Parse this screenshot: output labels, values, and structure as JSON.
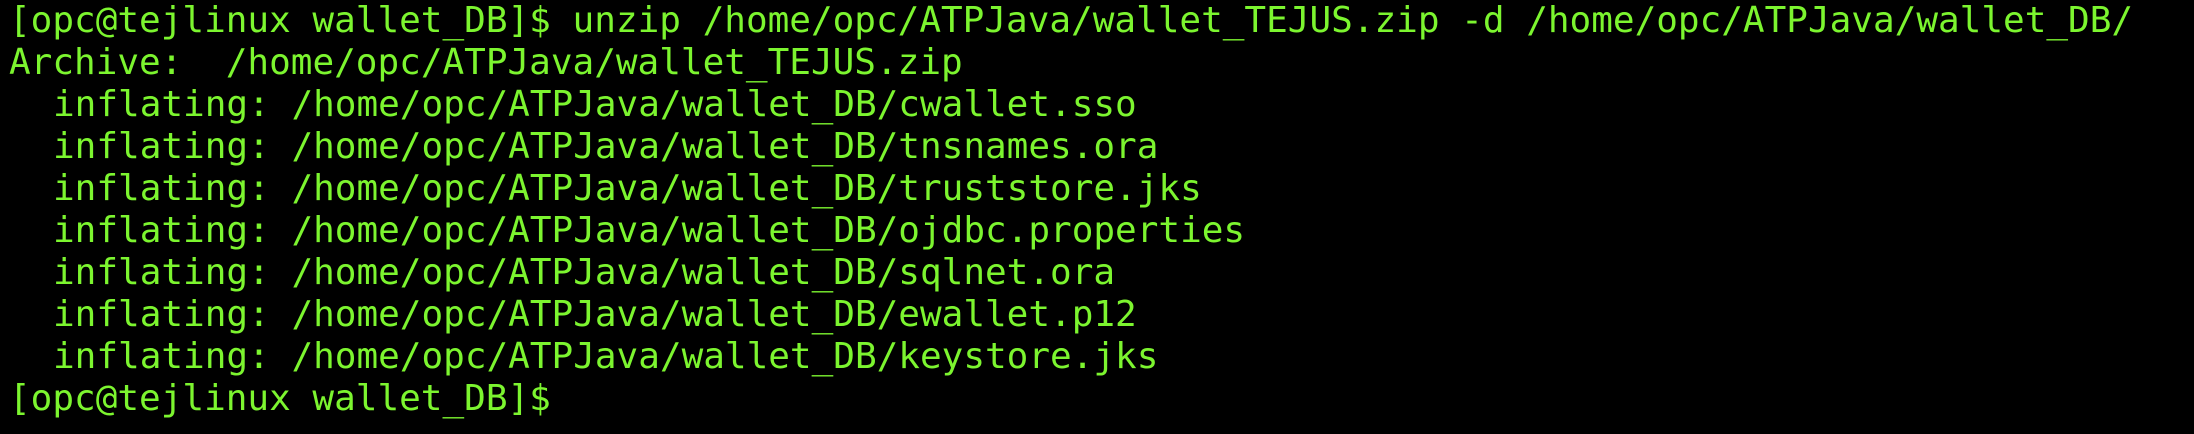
{
  "terminal": {
    "text_color": "#7cf52f",
    "background_color": "#000000",
    "command_line": {
      "prompt": "[opc@tejlinux wallet_DB]$",
      "command": "unzip /home/opc/ATPJava/wallet_TEJUS.zip -d /home/opc/ATPJava/wallet_DB/"
    },
    "archive_line": {
      "label": "Archive:",
      "path": "/home/opc/ATPJava/wallet_TEJUS.zip"
    },
    "inflating_lines": [
      {
        "label": "inflating:",
        "path": "/home/opc/ATPJava/wallet_DB/cwallet.sso"
      },
      {
        "label": "inflating:",
        "path": "/home/opc/ATPJava/wallet_DB/tnsnames.ora"
      },
      {
        "label": "inflating:",
        "path": "/home/opc/ATPJava/wallet_DB/truststore.jks"
      },
      {
        "label": "inflating:",
        "path": "/home/opc/ATPJava/wallet_DB/ojdbc.properties"
      },
      {
        "label": "inflating:",
        "path": "/home/opc/ATPJava/wallet_DB/sqlnet.ora"
      },
      {
        "label": "inflating:",
        "path": "/home/opc/ATPJava/wallet_DB/ewallet.p12"
      },
      {
        "label": "inflating:",
        "path": "/home/opc/ATPJava/wallet_DB/keystore.jks"
      }
    ],
    "final_prompt": "[opc@tejlinux wallet_DB]$"
  }
}
